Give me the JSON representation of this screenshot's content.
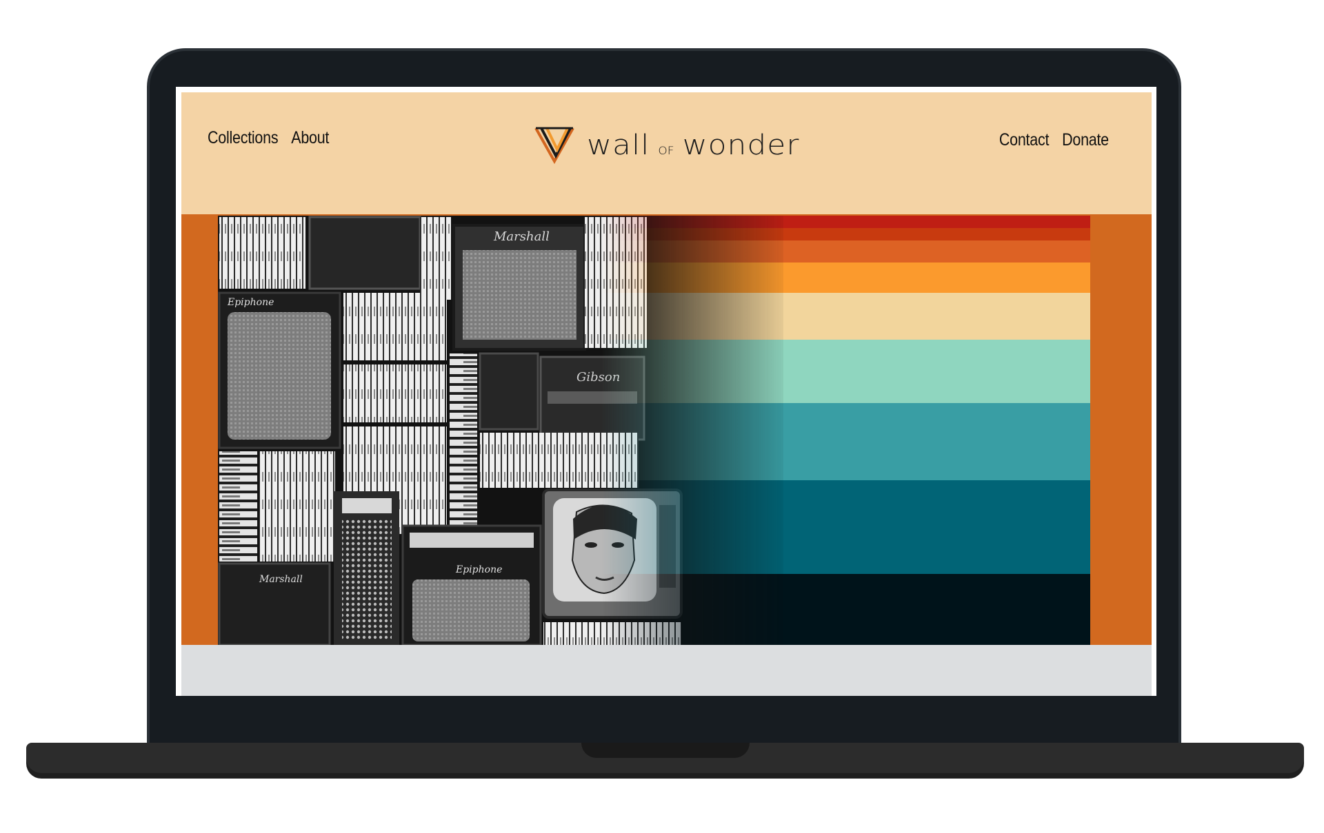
{
  "nav": {
    "left": [
      {
        "label": "Collections"
      },
      {
        "label": "About"
      }
    ],
    "right": [
      {
        "label": "Contact"
      },
      {
        "label": "Donate"
      }
    ]
  },
  "logo": {
    "word1": "wall",
    "word_of": "OF",
    "word2": "wonder",
    "icon": "triple-v-icon"
  },
  "hero": {
    "image_labels": [
      "Marshall",
      "Epiphone",
      "Gibson"
    ],
    "stripe_colors": [
      "#bf1e14",
      "#c83a0f",
      "#dd6224",
      "#fb9a2d",
      "#f2d59c",
      "#8fd6bf",
      "#399ea4",
      "#016476",
      "#00131a"
    ]
  },
  "colors": {
    "header_bg": "#f4d3a5",
    "hero_border": "#d2691f",
    "footer_strip": "#dcdee0"
  }
}
